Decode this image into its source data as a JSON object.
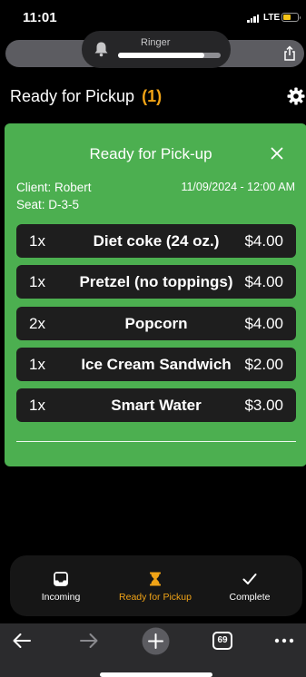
{
  "status_bar": {
    "time": "11:01",
    "network": "LTE",
    "battery_level": 0.55
  },
  "ringer": {
    "label": "Ringer",
    "volume": 0.84
  },
  "page": {
    "title": "Ready for Pickup",
    "count": "(1)"
  },
  "order_card": {
    "title": "Ready for Pick-up",
    "client": "Client: Robert",
    "seat": "Seat: D-3-5",
    "datetime": "11/09/2024 - 12:00 AM",
    "background_color": "#4caf50",
    "items": [
      {
        "qty": "1x",
        "name": "Diet coke (24 oz.)",
        "price": "$4.00"
      },
      {
        "qty": "1x",
        "name": "Pretzel (no toppings)",
        "price": "$4.00"
      },
      {
        "qty": "2x",
        "name": "Popcorn",
        "price": "$4.00"
      },
      {
        "qty": "1x",
        "name": "Ice Cream Sandwich",
        "price": "$2.00"
      },
      {
        "qty": "1x",
        "name": "Smart Water",
        "price": "$3.00"
      }
    ]
  },
  "tabs": [
    {
      "label": "Incoming",
      "icon": "inbox-icon",
      "active": false
    },
    {
      "label": "Ready for Pickup",
      "icon": "hourglass-icon",
      "active": true
    },
    {
      "label": "Complete",
      "icon": "checkmark-icon",
      "active": false
    }
  ],
  "accent_color": "#f0a316",
  "browser_toolbar": {
    "tab_count": "69"
  }
}
